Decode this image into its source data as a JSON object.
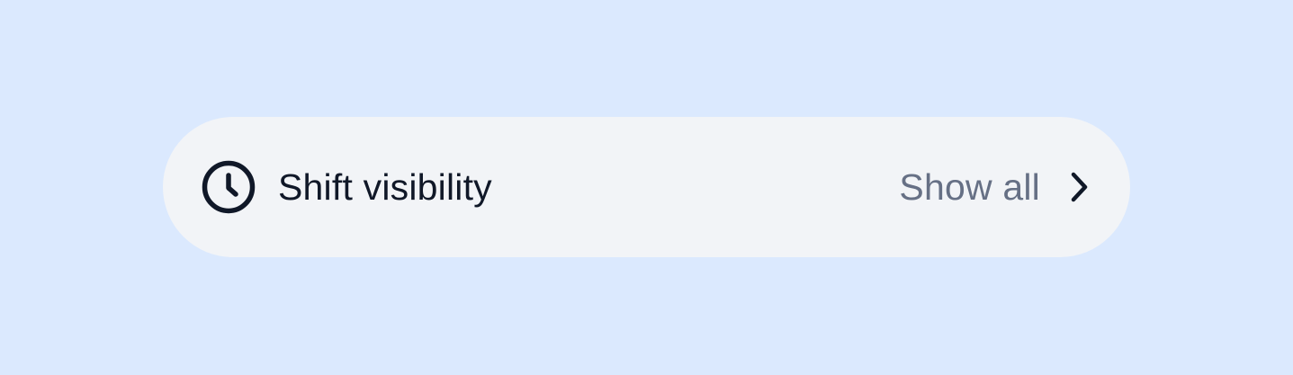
{
  "setting_row": {
    "icon": "clock-icon",
    "title": "Shift visibility",
    "action_label": "Show all",
    "chevron_icon": "chevron-right-icon"
  },
  "colors": {
    "background": "#dbe9fe",
    "row_background": "#f2f4f7",
    "title": "#101828",
    "action_label": "#667085",
    "icon": "#101828"
  }
}
